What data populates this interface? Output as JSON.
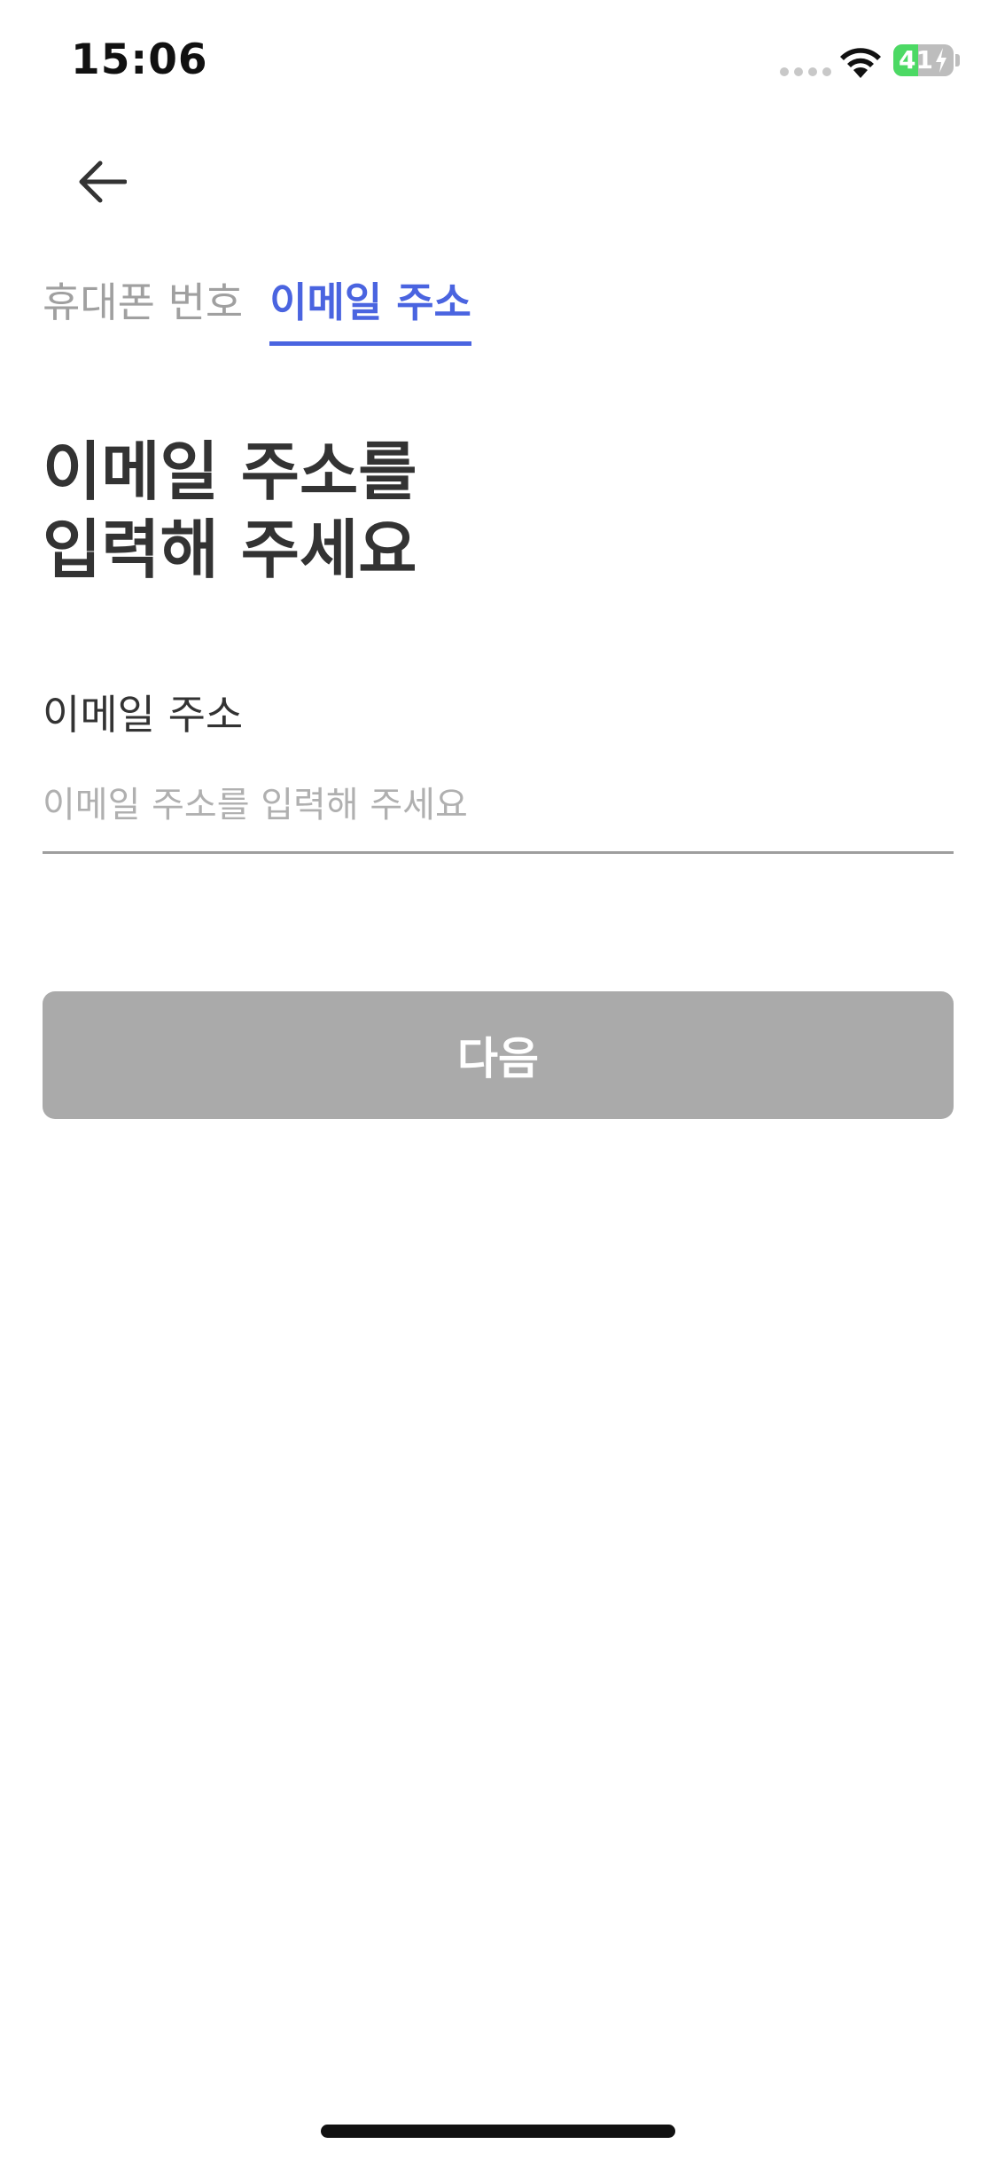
{
  "status_bar": {
    "time": "15:06",
    "battery_level": "41",
    "battery_fraction": 0.41,
    "battery_color": "#4cd964",
    "wifi_icon": "wifi-icon",
    "signal_icon": "cellular-signal-icon",
    "charging_icon": "bolt-icon"
  },
  "nav": {
    "back_icon": "arrow-left-icon"
  },
  "tabs": [
    {
      "label": "휴대폰 번호",
      "active": false
    },
    {
      "label": "이메일 주소",
      "active": true
    }
  ],
  "title": {
    "line1": "이메일 주소를",
    "line2": "입력해 주세요"
  },
  "form": {
    "email_label": "이메일 주소",
    "email_value": "",
    "email_placeholder": "이메일 주소를 입력해 주세요"
  },
  "actions": {
    "next_label": "다음",
    "next_enabled": false
  },
  "colors": {
    "accent": "#4a64e0",
    "disabled_button": "#aaaaaa",
    "inactive_tab": "#a0a0a0"
  }
}
